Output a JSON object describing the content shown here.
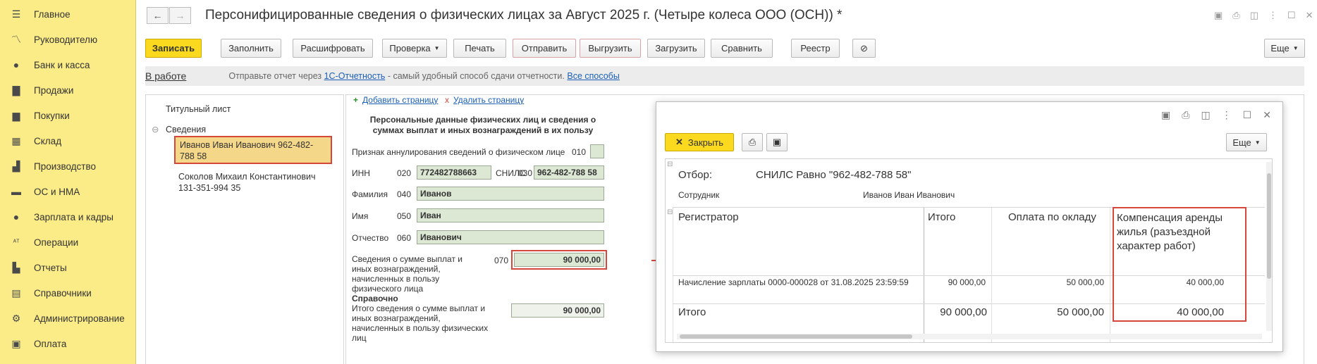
{
  "sidebar": {
    "items": [
      {
        "label": "Главное",
        "icon": "menu-icon"
      },
      {
        "label": "Руководителю",
        "icon": "chart-line-icon"
      },
      {
        "label": "Банк и касса",
        "icon": "coin-icon"
      },
      {
        "label": "Продажи",
        "icon": "bag-icon"
      },
      {
        "label": "Покупки",
        "icon": "cart-icon"
      },
      {
        "label": "Склад",
        "icon": "warehouse-icon"
      },
      {
        "label": "Производство",
        "icon": "factory-icon"
      },
      {
        "label": "ОС и НМА",
        "icon": "truck-icon"
      },
      {
        "label": "Зарплата и кадры",
        "icon": "person-icon"
      },
      {
        "label": "Операции",
        "icon": "operations-icon"
      },
      {
        "label": "Отчеты",
        "icon": "bar-chart-icon"
      },
      {
        "label": "Справочники",
        "icon": "book-icon"
      },
      {
        "label": "Администрирование",
        "icon": "gear-icon"
      },
      {
        "label": "Оплата",
        "icon": "wallet-icon"
      }
    ]
  },
  "header": {
    "title": "Персонифицированные сведения о физических лицах за Август 2025 г. (Четыре колеса ООО (ОСН)) *"
  },
  "toolbar": {
    "save": "Записать",
    "fill": "Заполнить",
    "decode": "Расшифровать",
    "check": "Проверка",
    "print": "Печать",
    "send": "Отправить",
    "upload": "Выгрузить",
    "load": "Загрузить",
    "compare": "Сравнить",
    "registry": "Реестр",
    "more": "Еще"
  },
  "infobar": {
    "status": "В работе",
    "hint_before": "Отправьте отчет через",
    "hint_link1": "1С-Отчетность",
    "hint_middle": "- самый удобный способ сдачи отчетности.",
    "hint_link2": "Все способы"
  },
  "tree": {
    "title_page": "Титульный лист",
    "section": "Сведения",
    "person1": "Иванов Иван Иванович 962-482-788 58",
    "person2": "Соколов Михаил Константинович 131-351-994 35"
  },
  "form": {
    "add_page": "Добавить страницу",
    "delete_page": "Удалить страницу",
    "heading": "Персональные данные физических лиц и сведения о суммах выплат и иных вознаграждений в их пользу",
    "cancel_label": "Признак аннулирования сведений о физическом лице",
    "cancel_code": "010",
    "inn_label": "ИНН",
    "inn_code": "020",
    "inn_value": "772482788663",
    "snils_label": "СНИЛС",
    "snils_code": "030",
    "snils_value": "962-482-788 58",
    "lastname_label": "Фамилия",
    "lastname_code": "040",
    "lastname_value": "Иванов",
    "firstname_label": "Имя",
    "firstname_code": "050",
    "firstname_value": "Иван",
    "patronymic_label": "Отчество",
    "patronymic_code": "060",
    "patronymic_value": "Иванович",
    "payments_label": "Сведения о сумме выплат и иных вознаграждений, начисленных в пользу физического лица",
    "payments_code": "070",
    "payments_value": "90 000,00",
    "ref_title": "Справочно",
    "ref_label": "Итого сведения о сумме выплат и иных вознаграждений, начисленных в пользу физических лиц",
    "ref_value": "90 000,00"
  },
  "popup": {
    "close": "Закрыть",
    "more": "Еще",
    "filter_label": "Отбор:",
    "filter_value": "СНИЛС Равно \"962-482-788 58\"",
    "employee_label": "Сотрудник",
    "employee_value": "Иванов Иван Иванович",
    "col_registrar": "Регистратор",
    "col_total": "Итого",
    "col_salary": "Оплата по окладу",
    "col_comp": "Компенсация аренды жилья (разъездной характер работ)",
    "row_doc": "Начисление зарплаты 0000-000028 от 31.08.2025 23:59:59",
    "row_total": "90 000,00",
    "row_salary": "50 000,00",
    "row_comp": "40 000,00",
    "sum_label": "Итого",
    "sum_total": "90 000,00",
    "sum_salary": "50 000,00",
    "sum_comp": "40 000,00"
  },
  "colors": {
    "sidebar": "#fbec88",
    "primary": "#fbd91f",
    "field": "#dce8d4",
    "highlight": "#d6473b"
  }
}
